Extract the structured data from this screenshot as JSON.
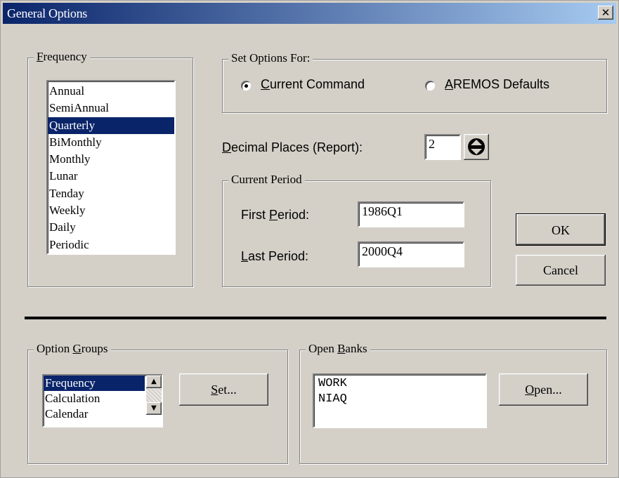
{
  "window": {
    "title": "General Options",
    "close_glyph": "✕"
  },
  "frequency": {
    "label_prefix": "",
    "label_mnemonic": "F",
    "label_rest": "requency",
    "items": [
      "Annual",
      "SemiAnnual",
      "Quarterly",
      "BiMonthly",
      "Monthly",
      "Lunar",
      "Tenday",
      "Weekly",
      "Daily",
      "Periodic"
    ],
    "selected_index": 2
  },
  "set_options": {
    "label": "Set Options For:",
    "current_command": {
      "mnemonic": "C",
      "rest": "urrent Command",
      "checked": true
    },
    "aremos_defaults": {
      "mnemonic": "A",
      "rest": "REMOS Defaults",
      "checked": false
    }
  },
  "decimal": {
    "label_mnemonic": "D",
    "label_rest": "ecimal Places (Report):",
    "value": "2",
    "spin_icon": "spin-updown-icon"
  },
  "current_period": {
    "label": "Current Period",
    "first": {
      "label_prefix": "First ",
      "label_mnemonic": "P",
      "label_rest": "eriod:",
      "value": "1986Q1"
    },
    "last": {
      "label_mnemonic": "L",
      "label_rest": "ast Period:",
      "value": "2000Q4"
    }
  },
  "buttons": {
    "ok": "OK",
    "cancel": "Cancel"
  },
  "option_groups": {
    "label_prefix": "Option ",
    "label_mnemonic": "G",
    "label_rest": "roups",
    "items": [
      "Frequency",
      "Calculation",
      "Calendar"
    ],
    "selected_index": 0,
    "set_mnemonic": "S",
    "set_rest": "et...",
    "scroll_up_icon": "▲",
    "scroll_down_icon": "▼"
  },
  "open_banks": {
    "label_prefix": "Open ",
    "label_mnemonic": "B",
    "label_rest": "anks",
    "items": [
      "WORK",
      "NIAQ"
    ],
    "open_mnemonic": "O",
    "open_rest": "pen..."
  }
}
